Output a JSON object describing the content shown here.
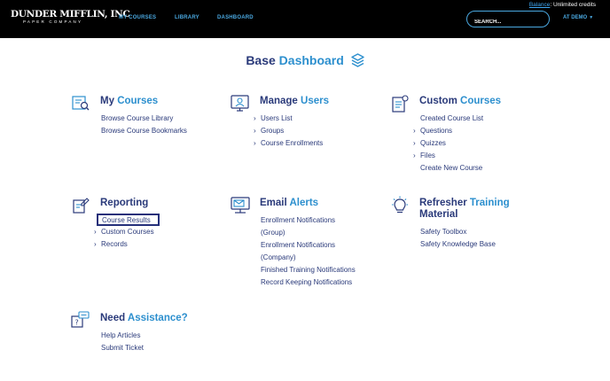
{
  "header": {
    "balance_link": "Balance",
    "balance_text": ": Unlimited credits",
    "logo_line1": "DUNDER MIFFLIN, INC",
    "logo_line2": "PAPER COMPANY",
    "nav": [
      "MY COURSES",
      "LIBRARY",
      "DASHBOARD"
    ],
    "search_placeholder": "SEARCH...",
    "account_label": "AT DEMO"
  },
  "page_title": {
    "part1": "Base",
    "part2": "Dashboard"
  },
  "sections": [
    {
      "id": "my-courses",
      "title_a": "My",
      "title_b": "Courses",
      "icon": "course-list-icon",
      "links": [
        {
          "label": "Browse Course Library",
          "chevron": false
        },
        {
          "label": "Browse Course Bookmarks",
          "chevron": false
        }
      ]
    },
    {
      "id": "manage-users",
      "title_a": "Manage",
      "title_b": "Users",
      "icon": "monitor-user-icon",
      "links": [
        {
          "label": "Users List",
          "chevron": true
        },
        {
          "label": "Groups",
          "chevron": true
        },
        {
          "label": "Course Enrollments",
          "chevron": true
        }
      ]
    },
    {
      "id": "custom-courses",
      "title_a": "Custom",
      "title_b": "Courses",
      "icon": "custom-course-icon",
      "links": [
        {
          "label": "Created Course List",
          "chevron": false
        },
        {
          "label": "Questions",
          "chevron": true
        },
        {
          "label": "Quizzes",
          "chevron": true
        },
        {
          "label": "Files",
          "chevron": true
        },
        {
          "label": "Create New Course",
          "chevron": false
        }
      ]
    },
    {
      "id": "reporting",
      "title_a": "Reporting",
      "title_b": "",
      "icon": "report-edit-icon",
      "links": [
        {
          "label": "Course Results",
          "chevron": false
        },
        {
          "label": "Custom Courses",
          "chevron": true
        },
        {
          "label": "Records",
          "chevron": true
        }
      ]
    },
    {
      "id": "email-alerts",
      "title_a": "Email",
      "title_b": "Alerts",
      "icon": "email-alert-icon",
      "links": [
        {
          "label": "Enrollment Notifications",
          "chevron": false
        },
        {
          "label": "(Group)",
          "chevron": false
        },
        {
          "label": "Enrollment Notifications",
          "chevron": false
        },
        {
          "label": "(Company)",
          "chevron": false
        },
        {
          "label": "Finished Training Notifications",
          "chevron": false
        },
        {
          "label": "Record Keeping Notifications",
          "chevron": false
        }
      ]
    },
    {
      "id": "refresher-training",
      "title_a": "Refresher",
      "title_b": "Training",
      "title_c": "Material",
      "icon": "lightbulb-icon",
      "links": [
        {
          "label": "Safety Toolbox",
          "chevron": false
        },
        {
          "label": "Safety Knowledge Base",
          "chevron": false
        }
      ]
    },
    {
      "id": "need-assistance",
      "title_a": "Need",
      "title_b": "Assistance?",
      "icon": "help-chat-icon",
      "links": [
        {
          "label": "Help Articles",
          "chevron": false
        },
        {
          "label": "Submit Ticket",
          "chevron": false
        }
      ]
    }
  ],
  "colors": {
    "navy": "#2a3a7a",
    "blue": "#2c8fce",
    "nav_blue": "#4aa8e0",
    "topbar": "#000000"
  }
}
